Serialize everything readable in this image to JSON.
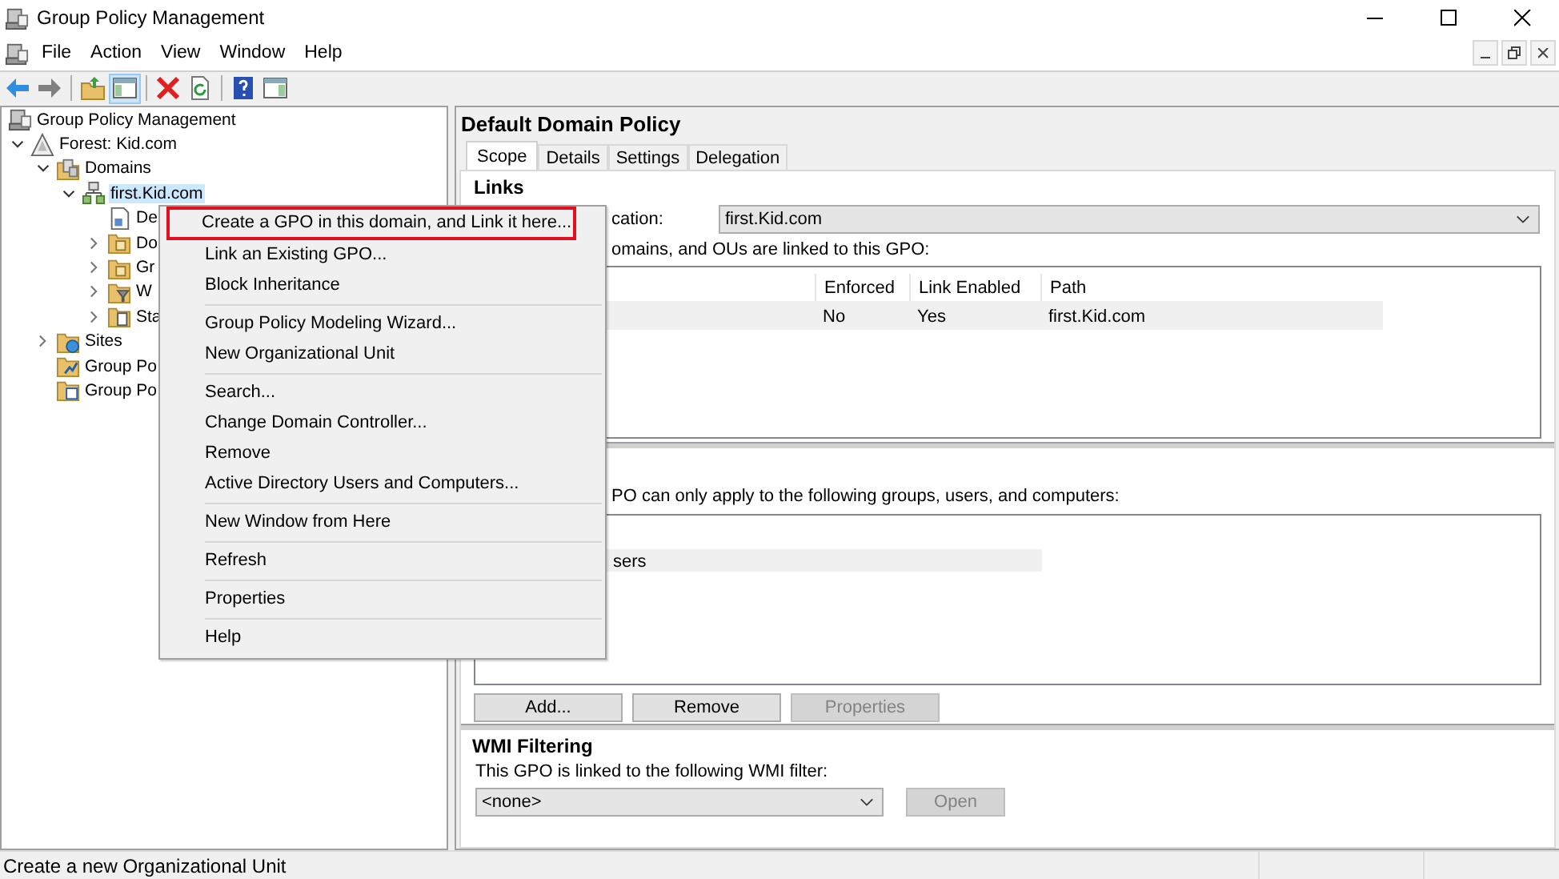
{
  "window": {
    "title": "Group Policy Management"
  },
  "menu_bar": [
    "File",
    "Action",
    "View",
    "Window",
    "Help"
  ],
  "tree": [
    {
      "label": "Group Policy Management",
      "kind": "console",
      "selected": false,
      "children": [
        {
          "label": "Forest: Kid.com",
          "kind": "forest",
          "expanded": true,
          "selected": false,
          "children": [
            {
              "label": "Domains",
              "kind": "domains",
              "expanded": true,
              "selected": false,
              "children": [
                {
                  "label": "first.Kid.com",
                  "kind": "domain",
                  "expanded": true,
                  "selected": true,
                  "children": [
                    {
                      "label": "De",
                      "kind": "gpo",
                      "selected": false
                    },
                    {
                      "label": "Do",
                      "kind": "ou",
                      "expanded": false,
                      "selected": false
                    },
                    {
                      "label": "Gr",
                      "kind": "ou",
                      "expanded": false,
                      "selected": false
                    },
                    {
                      "label": "W",
                      "kind": "filter",
                      "expanded": false,
                      "selected": false
                    },
                    {
                      "label": "Sta",
                      "kind": "starter",
                      "expanded": false,
                      "selected": false
                    }
                  ]
                }
              ]
            },
            {
              "label": "Sites",
              "kind": "sites",
              "expanded": false,
              "selected": false
            },
            {
              "label": "Group Po",
              "kind": "modeling",
              "selected": false
            },
            {
              "label": "Group Po",
              "kind": "results",
              "selected": false
            }
          ]
        }
      ]
    }
  ],
  "details": {
    "title": "Default Domain Policy",
    "tabs": [
      {
        "label": "Scope",
        "selected": true
      },
      {
        "label": "Details",
        "selected": false
      },
      {
        "label": "Settings",
        "selected": false
      },
      {
        "label": "Delegation",
        "selected": false
      }
    ],
    "links": {
      "heading": "Links",
      "location_label": "cation:",
      "location_value": "first.Kid.com",
      "note": "omains, and OUs are linked to this GPO:",
      "columns": [
        "Enforced",
        "Link Enabled",
        "Path"
      ],
      "rows": [
        {
          "cells": [
            "No",
            "Yes",
            "first.Kid.com"
          ],
          "selected": true
        }
      ]
    },
    "security": {
      "note": "PO can only apply to the following groups, users, and computers:",
      "rows": [
        {
          "label": "sers",
          "selected": true
        }
      ],
      "buttons": [
        {
          "label": "Add...",
          "disabled": false
        },
        {
          "label": "Remove",
          "disabled": false
        },
        {
          "label": "Properties",
          "disabled": true
        }
      ]
    },
    "wmi": {
      "heading": "WMI Filtering",
      "note": "This GPO is linked to the following WMI filter:",
      "filter_value": "<none>",
      "open_button": {
        "label": "Open",
        "disabled": true
      }
    }
  },
  "context_menu": {
    "groups": [
      [
        {
          "label": "Create a GPO in this domain, and Link it here...",
          "annotated": true
        },
        {
          "label": "Link an Existing GPO...",
          "annotated": false
        },
        {
          "label": "Block Inheritance",
          "annotated": false
        }
      ],
      [
        {
          "label": "Group Policy Modeling Wizard...",
          "annotated": false
        },
        {
          "label": "New Organizational Unit",
          "annotated": false
        }
      ],
      [
        {
          "label": "Search...",
          "annotated": false
        },
        {
          "label": "Change Domain Controller...",
          "annotated": false
        },
        {
          "label": "Remove",
          "annotated": false
        },
        {
          "label": "Active Directory Users and Computers...",
          "annotated": false
        }
      ],
      [
        {
          "label": "New Window from Here",
          "annotated": false
        }
      ],
      [
        {
          "label": "Refresh",
          "annotated": false
        }
      ],
      [
        {
          "label": "Properties",
          "annotated": false
        }
      ],
      [
        {
          "label": "Help",
          "annotated": false
        }
      ]
    ]
  },
  "status_bar": {
    "text": "Create a new Organizational Unit"
  }
}
